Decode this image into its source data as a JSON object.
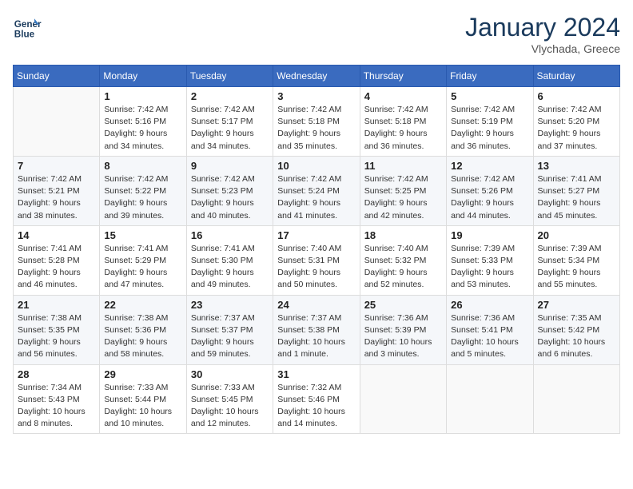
{
  "header": {
    "logo_line1": "General",
    "logo_line2": "Blue",
    "month_title": "January 2024",
    "location": "Vlychada, Greece"
  },
  "weekdays": [
    "Sunday",
    "Monday",
    "Tuesday",
    "Wednesday",
    "Thursday",
    "Friday",
    "Saturday"
  ],
  "weeks": [
    [
      {
        "day": "",
        "sunrise": "",
        "sunset": "",
        "daylight": ""
      },
      {
        "day": "1",
        "sunrise": "Sunrise: 7:42 AM",
        "sunset": "Sunset: 5:16 PM",
        "daylight": "Daylight: 9 hours and 34 minutes."
      },
      {
        "day": "2",
        "sunrise": "Sunrise: 7:42 AM",
        "sunset": "Sunset: 5:17 PM",
        "daylight": "Daylight: 9 hours and 34 minutes."
      },
      {
        "day": "3",
        "sunrise": "Sunrise: 7:42 AM",
        "sunset": "Sunset: 5:18 PM",
        "daylight": "Daylight: 9 hours and 35 minutes."
      },
      {
        "day": "4",
        "sunrise": "Sunrise: 7:42 AM",
        "sunset": "Sunset: 5:18 PM",
        "daylight": "Daylight: 9 hours and 36 minutes."
      },
      {
        "day": "5",
        "sunrise": "Sunrise: 7:42 AM",
        "sunset": "Sunset: 5:19 PM",
        "daylight": "Daylight: 9 hours and 36 minutes."
      },
      {
        "day": "6",
        "sunrise": "Sunrise: 7:42 AM",
        "sunset": "Sunset: 5:20 PM",
        "daylight": "Daylight: 9 hours and 37 minutes."
      }
    ],
    [
      {
        "day": "7",
        "sunrise": "Sunrise: 7:42 AM",
        "sunset": "Sunset: 5:21 PM",
        "daylight": "Daylight: 9 hours and 38 minutes."
      },
      {
        "day": "8",
        "sunrise": "Sunrise: 7:42 AM",
        "sunset": "Sunset: 5:22 PM",
        "daylight": "Daylight: 9 hours and 39 minutes."
      },
      {
        "day": "9",
        "sunrise": "Sunrise: 7:42 AM",
        "sunset": "Sunset: 5:23 PM",
        "daylight": "Daylight: 9 hours and 40 minutes."
      },
      {
        "day": "10",
        "sunrise": "Sunrise: 7:42 AM",
        "sunset": "Sunset: 5:24 PM",
        "daylight": "Daylight: 9 hours and 41 minutes."
      },
      {
        "day": "11",
        "sunrise": "Sunrise: 7:42 AM",
        "sunset": "Sunset: 5:25 PM",
        "daylight": "Daylight: 9 hours and 42 minutes."
      },
      {
        "day": "12",
        "sunrise": "Sunrise: 7:42 AM",
        "sunset": "Sunset: 5:26 PM",
        "daylight": "Daylight: 9 hours and 44 minutes."
      },
      {
        "day": "13",
        "sunrise": "Sunrise: 7:41 AM",
        "sunset": "Sunset: 5:27 PM",
        "daylight": "Daylight: 9 hours and 45 minutes."
      }
    ],
    [
      {
        "day": "14",
        "sunrise": "Sunrise: 7:41 AM",
        "sunset": "Sunset: 5:28 PM",
        "daylight": "Daylight: 9 hours and 46 minutes."
      },
      {
        "day": "15",
        "sunrise": "Sunrise: 7:41 AM",
        "sunset": "Sunset: 5:29 PM",
        "daylight": "Daylight: 9 hours and 47 minutes."
      },
      {
        "day": "16",
        "sunrise": "Sunrise: 7:41 AM",
        "sunset": "Sunset: 5:30 PM",
        "daylight": "Daylight: 9 hours and 49 minutes."
      },
      {
        "day": "17",
        "sunrise": "Sunrise: 7:40 AM",
        "sunset": "Sunset: 5:31 PM",
        "daylight": "Daylight: 9 hours and 50 minutes."
      },
      {
        "day": "18",
        "sunrise": "Sunrise: 7:40 AM",
        "sunset": "Sunset: 5:32 PM",
        "daylight": "Daylight: 9 hours and 52 minutes."
      },
      {
        "day": "19",
        "sunrise": "Sunrise: 7:39 AM",
        "sunset": "Sunset: 5:33 PM",
        "daylight": "Daylight: 9 hours and 53 minutes."
      },
      {
        "day": "20",
        "sunrise": "Sunrise: 7:39 AM",
        "sunset": "Sunset: 5:34 PM",
        "daylight": "Daylight: 9 hours and 55 minutes."
      }
    ],
    [
      {
        "day": "21",
        "sunrise": "Sunrise: 7:38 AM",
        "sunset": "Sunset: 5:35 PM",
        "daylight": "Daylight: 9 hours and 56 minutes."
      },
      {
        "day": "22",
        "sunrise": "Sunrise: 7:38 AM",
        "sunset": "Sunset: 5:36 PM",
        "daylight": "Daylight: 9 hours and 58 minutes."
      },
      {
        "day": "23",
        "sunrise": "Sunrise: 7:37 AM",
        "sunset": "Sunset: 5:37 PM",
        "daylight": "Daylight: 9 hours and 59 minutes."
      },
      {
        "day": "24",
        "sunrise": "Sunrise: 7:37 AM",
        "sunset": "Sunset: 5:38 PM",
        "daylight": "Daylight: 10 hours and 1 minute."
      },
      {
        "day": "25",
        "sunrise": "Sunrise: 7:36 AM",
        "sunset": "Sunset: 5:39 PM",
        "daylight": "Daylight: 10 hours and 3 minutes."
      },
      {
        "day": "26",
        "sunrise": "Sunrise: 7:36 AM",
        "sunset": "Sunset: 5:41 PM",
        "daylight": "Daylight: 10 hours and 5 minutes."
      },
      {
        "day": "27",
        "sunrise": "Sunrise: 7:35 AM",
        "sunset": "Sunset: 5:42 PM",
        "daylight": "Daylight: 10 hours and 6 minutes."
      }
    ],
    [
      {
        "day": "28",
        "sunrise": "Sunrise: 7:34 AM",
        "sunset": "Sunset: 5:43 PM",
        "daylight": "Daylight: 10 hours and 8 minutes."
      },
      {
        "day": "29",
        "sunrise": "Sunrise: 7:33 AM",
        "sunset": "Sunset: 5:44 PM",
        "daylight": "Daylight: 10 hours and 10 minutes."
      },
      {
        "day": "30",
        "sunrise": "Sunrise: 7:33 AM",
        "sunset": "Sunset: 5:45 PM",
        "daylight": "Daylight: 10 hours and 12 minutes."
      },
      {
        "day": "31",
        "sunrise": "Sunrise: 7:32 AM",
        "sunset": "Sunset: 5:46 PM",
        "daylight": "Daylight: 10 hours and 14 minutes."
      },
      {
        "day": "",
        "sunrise": "",
        "sunset": "",
        "daylight": ""
      },
      {
        "day": "",
        "sunrise": "",
        "sunset": "",
        "daylight": ""
      },
      {
        "day": "",
        "sunrise": "",
        "sunset": "",
        "daylight": ""
      }
    ]
  ]
}
